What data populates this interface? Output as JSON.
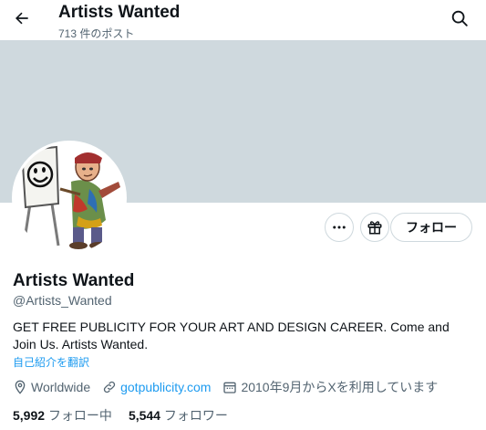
{
  "header": {
    "title": "Artists Wanted",
    "post_count": "713 件のポスト"
  },
  "profile": {
    "display_name": "Artists Wanted",
    "handle": "@Artists_Wanted",
    "bio": "GET FREE PUBLICITY FOR YOUR ART AND DESIGN CAREER. Come and Join Us. Artists Wanted.",
    "translate_label": "自己紹介を翻訳",
    "location": "Worldwide",
    "website": "gotpublicity.com",
    "joined": "2010年9月からXを利用しています"
  },
  "actions": {
    "follow_label": "フォロー"
  },
  "stats": {
    "following_count": "5,992",
    "following_label": "フォロー中",
    "followers_count": "5,544",
    "followers_label": "フォロワー"
  },
  "colors": {
    "banner": "#cfd9de",
    "accent": "#1d9bf0",
    "text": "#0f1419",
    "secondary": "#536471"
  },
  "icons": [
    "arrow-left-icon",
    "search-icon",
    "more-icon",
    "gift-icon",
    "location-icon",
    "link-icon",
    "calendar-icon"
  ]
}
